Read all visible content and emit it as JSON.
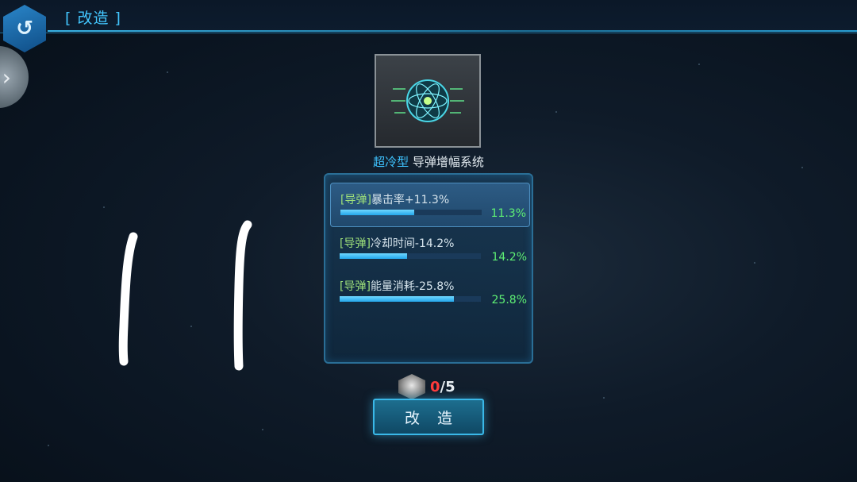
{
  "header": {
    "title": "[ 改造 ]",
    "back_icon": "back-arrow-icon",
    "side_icon": "chevron-right-icon"
  },
  "item": {
    "icon": "atom-circuit-icon",
    "grade": "超冷型",
    "name": "导弹增幅系统"
  },
  "stats": [
    {
      "tag": "[导弹]",
      "text": "暴击率+11.3%",
      "progress": 0.52,
      "value": "11.3%",
      "selected": true
    },
    {
      "tag": "[导弹]",
      "text": "冷却时间-14.2%",
      "progress": 0.48,
      "value": "14.2%",
      "selected": false
    },
    {
      "tag": "[导弹]",
      "text": "能量消耗-25.8%",
      "progress": 0.81,
      "value": "25.8%",
      "selected": false
    }
  ],
  "cost": {
    "icon": "material-core-icon",
    "have": "0",
    "need": "/5"
  },
  "action": {
    "label": "改 造"
  },
  "colors": {
    "accent": "#3ec3ff",
    "stat_value": "#5ef074",
    "insufficient": "#ff3b3b"
  }
}
